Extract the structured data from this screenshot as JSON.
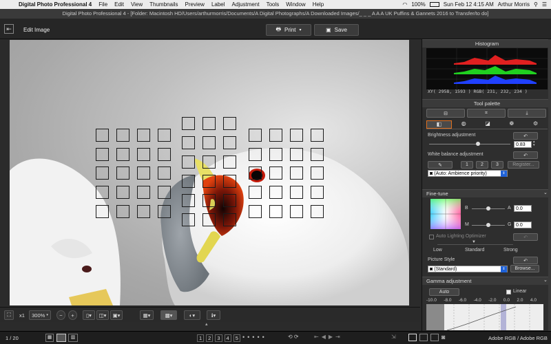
{
  "menubar": {
    "app": "Digital Photo Professional 4",
    "items": [
      "File",
      "Edit",
      "View",
      "Thumbnails",
      "Preview",
      "Label",
      "Adjustment",
      "Tools",
      "Window",
      "Help"
    ],
    "battery": "100%",
    "clock": "Sun Feb 12  4:15 AM",
    "user": "Arthur Morris"
  },
  "window": {
    "title": "Digital Photo Professional 4 - [Folder: Macintosh HD/Users/arthurmorris/Documents/A Digital Photographs/A Downloaded Images/_ _ _ A A A  UK Puffins & Gannets 2016 to Transfer/to do]"
  },
  "toolbar": {
    "mode": "Edit Image",
    "print_label": "Print",
    "save_label": "Save"
  },
  "viewer": {
    "zoom_1x": "x1",
    "zoom": "300%"
  },
  "status": {
    "count": "1 / 20",
    "color_space": "Adobe RGB / Adobe RGB",
    "labels": [
      "1",
      "2",
      "3",
      "4",
      "5"
    ]
  },
  "histogram": {
    "title": "Histogram",
    "readout": "XY(  2958,  1593 ) RGB( 231, 232, 234 )"
  },
  "tool_palette": {
    "title": "Tool palette",
    "brightness_label": "Brightness adjustment",
    "brightness_value": "0.83",
    "brightness_level": 0.6,
    "wb_label": "White balance adjustment",
    "wb_buttons": [
      "1",
      "2",
      "3"
    ],
    "register_label": "Register...",
    "wb_select": "(Auto: Ambience priority)"
  },
  "fine_tune": {
    "title": "Fine-tune",
    "b_label": "B",
    "a_label": "A",
    "a_value": "0.0",
    "m_label": "M",
    "g_label": "G",
    "g_value": "0.0",
    "alo_label": "Auto Lighting Optimizer",
    "alo_levels": [
      "Low",
      "Standard",
      "Strong"
    ],
    "picture_style_label": "Picture Style",
    "picture_style_value": "(Standard)",
    "browse_label": "Browse..."
  },
  "gamma": {
    "title": "Gamma adjustment",
    "auto_label": "Auto",
    "linear_label": "Linear",
    "scale": [
      "-10.0",
      "-8.0",
      "-6.0",
      "-4.0",
      "-2.0",
      "0.0",
      "2.0",
      "4.0"
    ]
  },
  "colors": {
    "accent": "#1f62d8",
    "histogram_red": "#e02020",
    "histogram_green": "#20d020",
    "histogram_blue": "#2040ff"
  }
}
